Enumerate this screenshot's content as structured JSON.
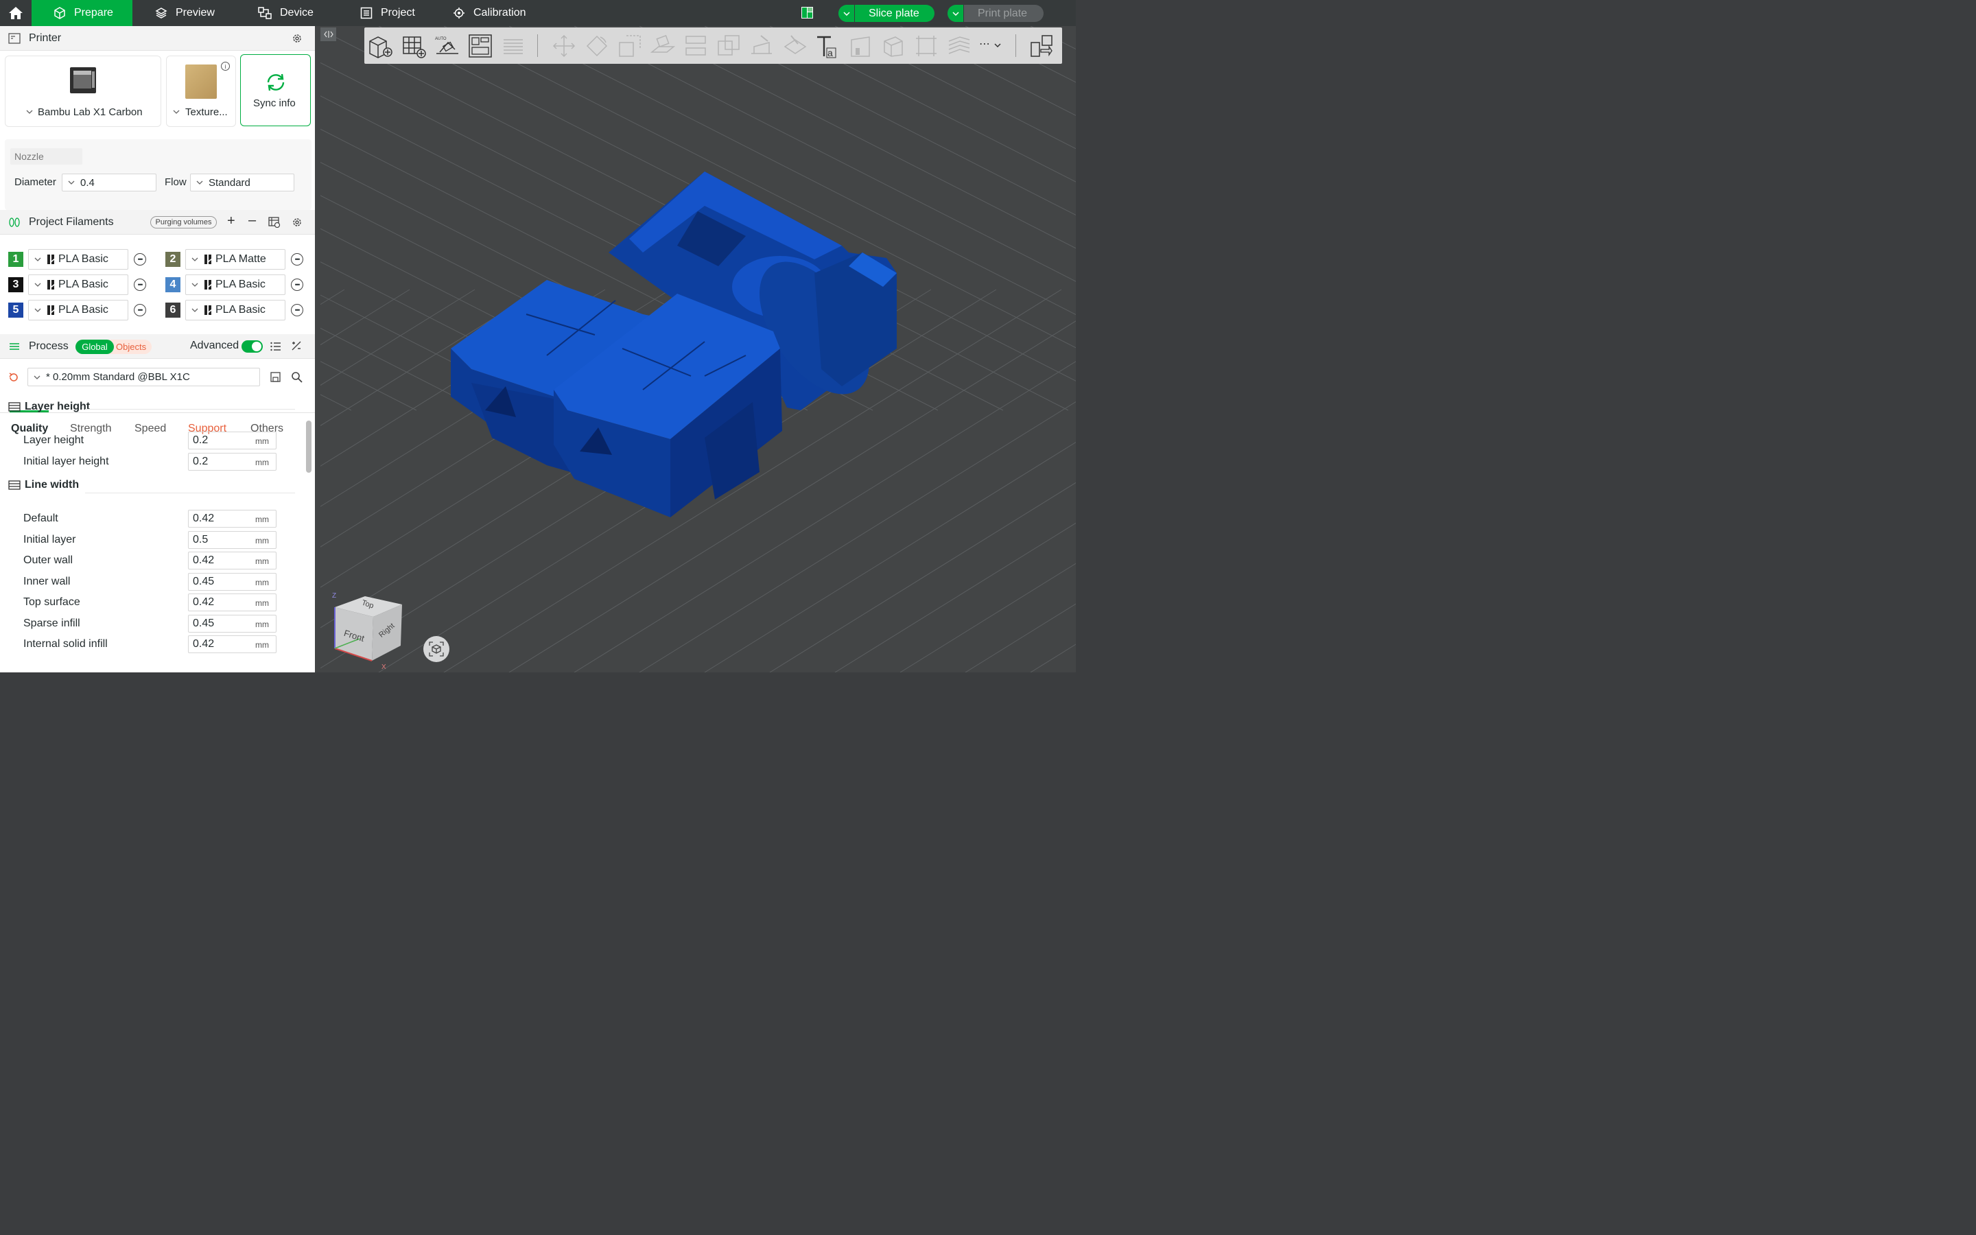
{
  "topbar": {
    "tabs": [
      {
        "label": "Prepare",
        "icon": "cube-icon",
        "active": true
      },
      {
        "label": "Preview",
        "icon": "layers-icon"
      },
      {
        "label": "Device",
        "icon": "device-icon"
      },
      {
        "label": "Project",
        "icon": "project-icon"
      },
      {
        "label": "Calibration",
        "icon": "calibration-icon"
      }
    ],
    "slice_label": "Slice plate",
    "print_label": "Print plate"
  },
  "printer": {
    "title": "Printer",
    "printer_name": "Bambu Lab X1 Carbon",
    "plate_name": "Texture...",
    "sync_label": "Sync info",
    "nozzle_label": "Nozzle",
    "diameter_label": "Diameter",
    "diameter_value": "0.4",
    "flow_label": "Flow",
    "flow_value": "Standard"
  },
  "filaments": {
    "title": "Project Filaments",
    "purging_label": "Purging volumes",
    "items": [
      {
        "num": "1",
        "name": "PLA Basic",
        "color": "#2a9d3d"
      },
      {
        "num": "2",
        "name": "PLA Matte",
        "color": "#6e7352"
      },
      {
        "num": "3",
        "name": "PLA Basic",
        "color": "#111111"
      },
      {
        "num": "4",
        "name": "PLA Basic",
        "color": "#4a86c8"
      },
      {
        "num": "5",
        "name": "PLA Basic",
        "color": "#1c46a6"
      },
      {
        "num": "6",
        "name": "PLA Basic",
        "color": "#3d3d3d"
      }
    ]
  },
  "process": {
    "title": "Process",
    "global_label": "Global",
    "objects_label": "Objects",
    "advanced_label": "Advanced",
    "profile": "* 0.20mm Standard @BBL X1C",
    "tabs": [
      "Quality",
      "Strength",
      "Speed",
      "Support",
      "Others"
    ],
    "groups": [
      {
        "title": "Layer height",
        "params": [
          {
            "label": "Layer height",
            "value": "0.2",
            "unit": "mm"
          },
          {
            "label": "Initial layer height",
            "value": "0.2",
            "unit": "mm"
          }
        ]
      },
      {
        "title": "Line width",
        "params": [
          {
            "label": "Default",
            "value": "0.42",
            "unit": "mm"
          },
          {
            "label": "Initial layer",
            "value": "0.5",
            "unit": "mm"
          },
          {
            "label": "Outer wall",
            "value": "0.42",
            "unit": "mm"
          },
          {
            "label": "Inner wall",
            "value": "0.45",
            "unit": "mm"
          },
          {
            "label": "Top surface",
            "value": "0.42",
            "unit": "mm"
          },
          {
            "label": "Sparse infill",
            "value": "0.45",
            "unit": "mm"
          },
          {
            "label": "Internal solid infill",
            "value": "0.42",
            "unit": "mm"
          }
        ]
      }
    ]
  },
  "viewcube": {
    "top": "Top",
    "front": "Front",
    "right": "Right",
    "z": "Z",
    "x": "X"
  },
  "colors": {
    "accent": "#00ae42",
    "model": "#0d47b8",
    "support_tab": "#e8603c"
  }
}
